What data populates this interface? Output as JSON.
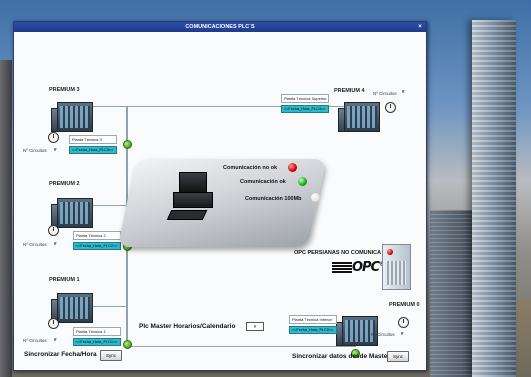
{
  "window": {
    "title": "COMUNICACIONES PLC´S",
    "close_glyph": "×"
  },
  "plcs": {
    "p3": {
      "title": "PREMIUM 3",
      "circuitos_label": "Nº Circuitos",
      "circuitos_value": "#",
      "area": "Planta Técnica 3",
      "fecha": "<<Fecha_Hora_PLC3>>"
    },
    "p2": {
      "title": "PREMIUM 2",
      "circuitos_label": "Nº Circuitos",
      "circuitos_value": "#",
      "area": "Planta Técnica 2",
      "fecha": "<<Fecha_Hora_PLC2>>"
    },
    "p1": {
      "title": "PREMIUM 1",
      "circuitos_label": "Nº Circuitos",
      "circuitos_value": "#",
      "area": "Planta Técnica 1",
      "fecha": "<<Fecha_Hora_PLC1>>"
    },
    "p4": {
      "title": "PREMIUM 4",
      "circuitos_label": "Nº Circuitos",
      "circuitos_value": "#",
      "area": "Planta Técnica Superior",
      "fecha": "<<Fecha_Hora_PLC4>>"
    },
    "p0": {
      "title": "PREMIUM 0",
      "circuitos_label": "Nº Circuitos",
      "circuitos_value": "#",
      "area": "Planta Técnica Inferior",
      "fecha": "<<Fecha_Hora_PLC0>>"
    }
  },
  "legend": {
    "no_ok": "Comunicación no ok",
    "ok": "Comunicación ok",
    "mb100": "Comunicación 100Mb"
  },
  "opc": {
    "label": "OPC PERSIANAS NO COMUNICA",
    "logo_text": "OPC",
    "logo_mark": "®"
  },
  "master": {
    "label": "Plc Master Horarios/Calendario",
    "value": "#"
  },
  "bottom": {
    "sync_datetime_label": "Sincronizar Fecha/Hora",
    "sync_datetime_button": "Sync",
    "sync_master_label": "Sincronizar datos desde Master",
    "sync_master_button": "Sync"
  },
  "colors": {
    "titlebar": "#1e3a8c",
    "node_green": "#47a31c",
    "date_field": "#2fb8c8",
    "led_red": "#d10000",
    "led_green": "#14a614"
  }
}
